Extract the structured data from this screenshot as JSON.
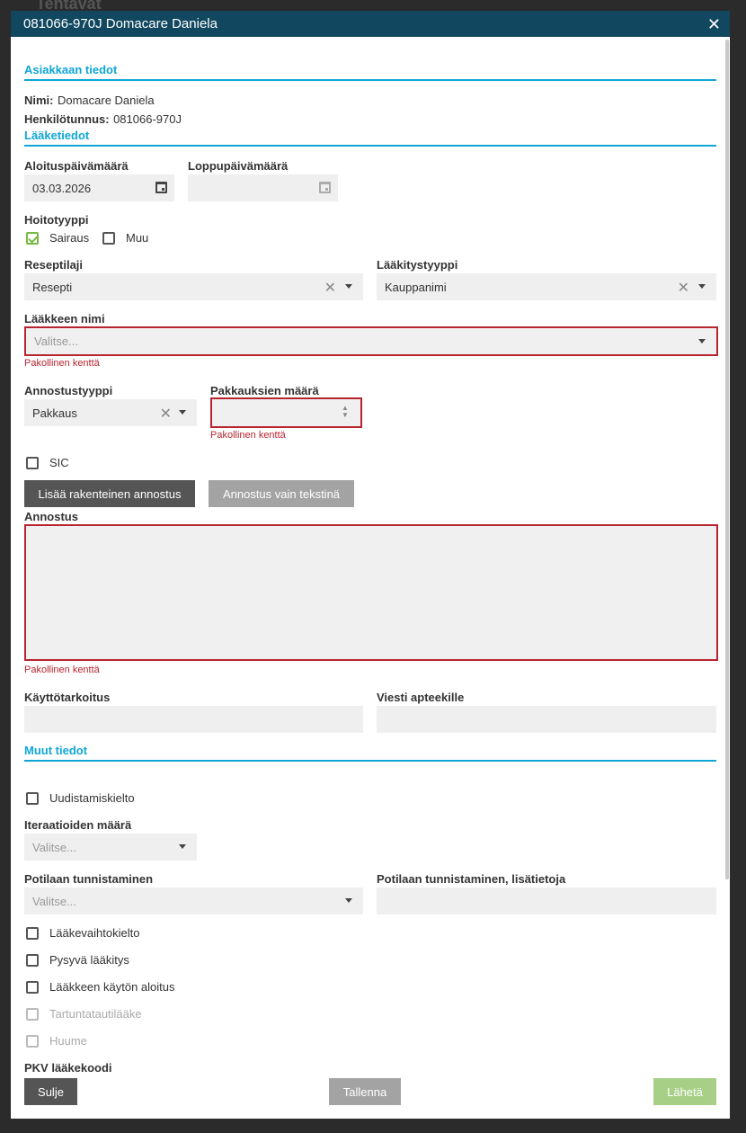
{
  "backdrop": {
    "title": "Tehtävät"
  },
  "modal": {
    "title": "081066-970J Domacare Daniela",
    "close_icon": "close-icon"
  },
  "client": {
    "section_title": "Asiakkaan tiedot",
    "name_label": "Nimi:",
    "name_value": "Domacare Daniela",
    "ssn_label": "Henkilötunnus:",
    "ssn_value": "081066-970J"
  },
  "medicine": {
    "section_title": "Lääketiedot",
    "start_date_label": "Aloituspäivämäärä",
    "start_date_value": "03.03.2026",
    "end_date_label": "Loppupäivämäärä",
    "end_date_value": "",
    "treatment_type_label": "Hoitotyyppi",
    "treatment_sairaus": "Sairaus",
    "treatment_muu": "Muu",
    "prescription_type_label": "Reseptilaji",
    "prescription_type_value": "Resepti",
    "medication_type_label": "Lääkitystyyppi",
    "medication_type_value": "Kauppanimi",
    "medicine_name_label": "Lääkkeen nimi",
    "medicine_name_placeholder": "Valitse...",
    "required_error": "Pakollinen kenttä",
    "dosage_type_label": "Annostustyyppi",
    "dosage_type_value": "Pakkaus",
    "package_count_label": "Pakkauksien määrä",
    "sic_label": "SIC",
    "add_structured_dosage": "Lisää rakenteinen annostus",
    "dosage_text_only": "Annostus vain tekstinä",
    "dosage_label": "Annostus",
    "purpose_label": "Käyttötarkoitus",
    "message_label": "Viesti apteekille"
  },
  "other": {
    "section_title": "Muut tiedot",
    "renewal_ban": "Uudistamiskielto",
    "iterations_label": "Iteraatioiden määrä",
    "iterations_placeholder": "Valitse...",
    "patient_id_label": "Potilaan tunnistaminen",
    "patient_id_placeholder": "Valitse...",
    "patient_id_extra_label": "Potilaan tunnistaminen, lisätietoja",
    "substitution_ban": "Lääkevaihtokielto",
    "permanent_medication": "Pysyvä lääkitys",
    "start_of_use": "Lääkkeen käytön aloitus",
    "infectious_disease": "Tartuntatautilääke",
    "narcotic": "Huume",
    "pkv_label": "PKV lääkekoodi"
  },
  "footer": {
    "close": "Sulje",
    "save": "Tallenna",
    "send": "Lähetä"
  }
}
